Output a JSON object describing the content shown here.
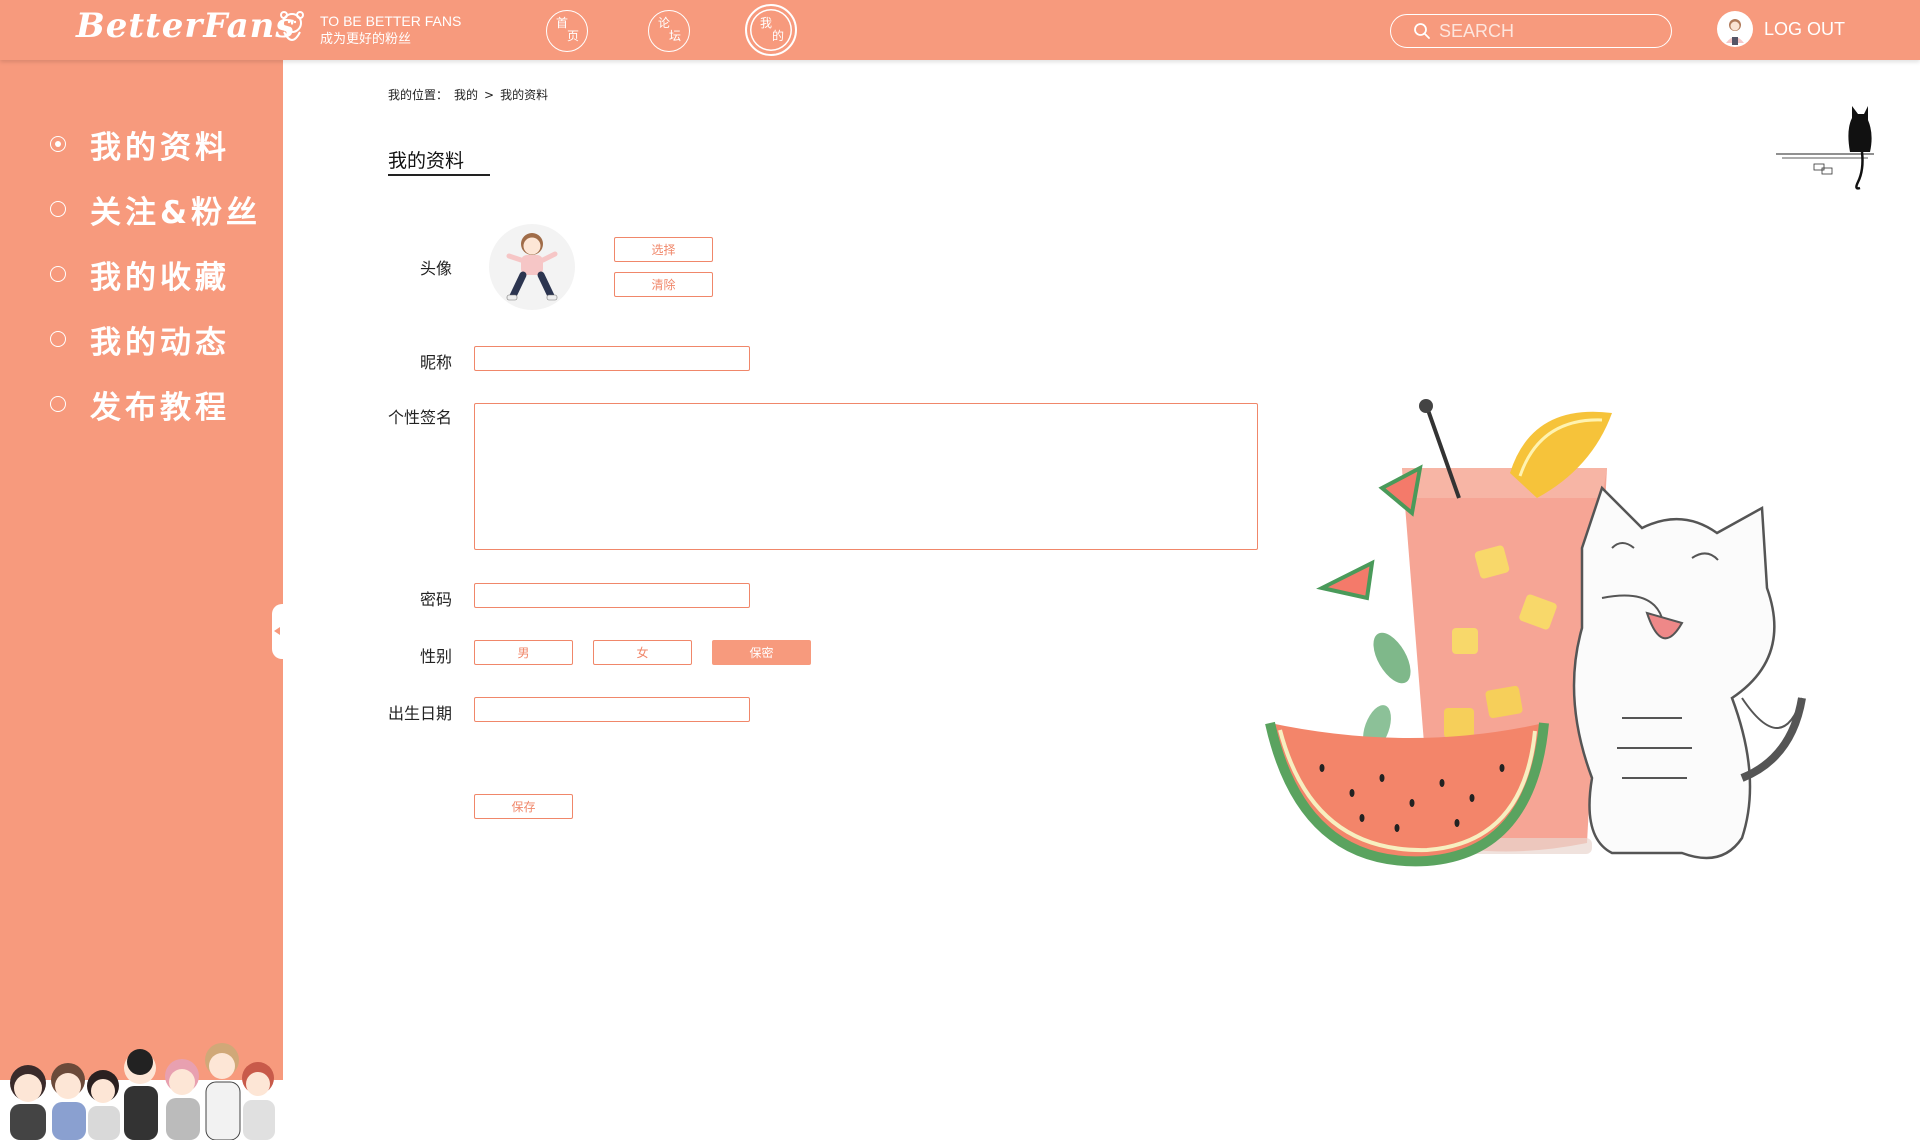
{
  "header": {
    "logo": "BetterFans",
    "tagline_en": "TO BE BETTER FANS",
    "tagline_cn": "成为更好的粉丝",
    "nav": [
      {
        "top": "首",
        "bottom": "页"
      },
      {
        "top": "论",
        "bottom": "坛"
      },
      {
        "top": "我",
        "bottom": "的"
      }
    ],
    "search_placeholder": "SEARCH",
    "logout": "LOG OUT"
  },
  "sidebar": {
    "items": [
      {
        "label": "我的资料",
        "selected": true
      },
      {
        "label": "关注&粉丝",
        "selected": false
      },
      {
        "label": "我的收藏",
        "selected": false
      },
      {
        "label": "我的动态",
        "selected": false
      },
      {
        "label": "发布教程",
        "selected": false
      }
    ]
  },
  "breadcrumb": {
    "prefix": "我的位置：",
    "level1": "我的",
    "sep": ">",
    "level2": "我的资料"
  },
  "page_title": "我的资料",
  "form": {
    "avatar_label": "头像",
    "choose_button": "选择",
    "clear_button": "清除",
    "nickname_label": "昵称",
    "nickname_value": "",
    "signature_label": "个性签名",
    "signature_value": "",
    "password_label": "密码",
    "password_value": "",
    "gender_label": "性别",
    "gender_options": [
      "男",
      "女",
      "保密"
    ],
    "gender_selected": "保密",
    "birthday_label": "出生日期",
    "birthday_value": "",
    "save_button": "保存"
  },
  "colors": {
    "accent": "#f79a7d",
    "border": "#f0876a"
  }
}
